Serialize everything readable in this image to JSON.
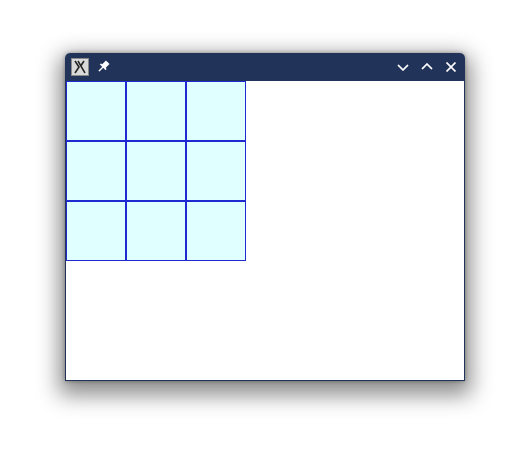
{
  "window": {
    "icons": {
      "app": "x-window-app-icon",
      "pin": "pin-icon",
      "minimize": "chevron-down-icon",
      "maximize": "chevron-up-icon",
      "close": "close-icon"
    },
    "colors": {
      "titlebar": "#22335a",
      "titlebar_icons": "#ffffff",
      "client_background": "#ffffff"
    }
  },
  "grid": {
    "rows": 3,
    "columns": 3,
    "cell_fill": "#e0ffff",
    "cell_border": "#1f2bd0"
  }
}
